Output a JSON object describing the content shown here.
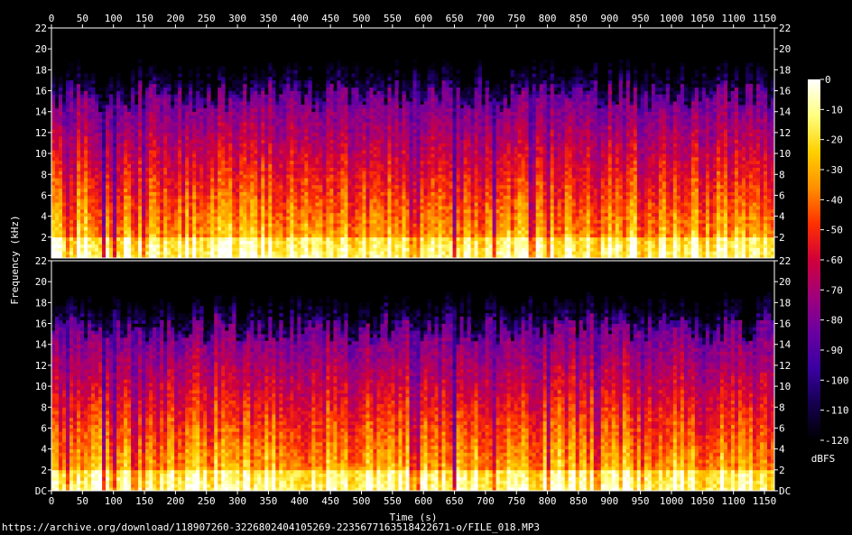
{
  "chart_data": {
    "type": "heatmap",
    "title": "",
    "xlabel": "Time (s)",
    "ylabel": "Frequency (kHz)",
    "xlim": [
      0,
      1166
    ],
    "ylim": [
      0,
      22
    ],
    "x_ticks": [
      "0",
      "50",
      "100",
      "150",
      "200",
      "250",
      "300",
      "350",
      "400",
      "450",
      "500",
      "550",
      "600",
      "650",
      "700",
      "750",
      "800",
      "850",
      "900",
      "950",
      "1000",
      "1050",
      "1100",
      "1150"
    ],
    "y_ticks_upper": [
      "22",
      "20",
      "18",
      "16",
      "14",
      "12",
      "10",
      "8",
      "6",
      "4",
      "2"
    ],
    "y_ticks_lower": [
      "22",
      "20",
      "18",
      "16",
      "14",
      "12",
      "10",
      "8",
      "6",
      "4",
      "2",
      "DC"
    ],
    "channels": 2,
    "colorbar": {
      "label": "dBFS",
      "range": [
        -120,
        0
      ],
      "ticks": [
        "0",
        "-10",
        "-20",
        "-30",
        "-40",
        "-50",
        "-60",
        "-70",
        "-80",
        "-90",
        "-100",
        "-110",
        "-120"
      ],
      "colormap": [
        "#ffffff",
        "#ffff80",
        "#ffd000",
        "#ff9000",
        "#ff3000",
        "#d0003a",
        "#a0007a",
        "#6a00a0",
        "#3a00a0",
        "#14004e",
        "#000000"
      ]
    },
    "features": {
      "content_ceiling_khz": 16,
      "dense_energy_below_khz": 6,
      "quiet_gaps_s": [
        28,
        85,
        103,
        135,
        150,
        582,
        590,
        650,
        715,
        775,
        800,
        880,
        955,
        1050
      ]
    }
  },
  "source_url": "https://archive.org/download/118907260-3226802404105269-2235677163518422671-o/FILE_018.MP3"
}
